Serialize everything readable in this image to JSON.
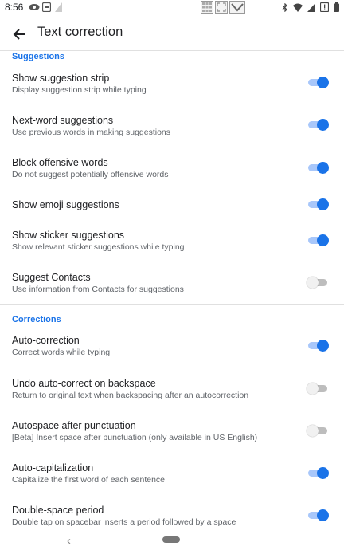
{
  "statusbar": {
    "time": "8:56"
  },
  "appbar": {
    "title": "Text correction"
  },
  "sections": [
    {
      "header": "Suggestions",
      "items": [
        {
          "title": "Show suggestion strip",
          "summary": "Display suggestion strip while typing",
          "on": true
        },
        {
          "title": "Next-word suggestions",
          "summary": "Use previous words in making suggestions",
          "on": true
        },
        {
          "title": "Block offensive words",
          "summary": "Do not suggest potentially offensive words",
          "on": true
        },
        {
          "title": "Show emoji suggestions",
          "summary": "",
          "on": true
        },
        {
          "title": "Show sticker suggestions",
          "summary": "Show relevant sticker suggestions while typing",
          "on": true
        },
        {
          "title": "Suggest Contacts",
          "summary": "Use information from Contacts for suggestions",
          "on": false
        }
      ]
    },
    {
      "header": "Corrections",
      "items": [
        {
          "title": "Auto-correction",
          "summary": "Correct words while typing",
          "on": true
        },
        {
          "title": "Undo auto-correct on backspace",
          "summary": "Return to original text when backspacing after an autocorrection",
          "on": false
        },
        {
          "title": "Autospace after punctuation",
          "summary": "[Beta] Insert space after punctuation (only available in US English)",
          "on": false
        },
        {
          "title": "Auto-capitalization",
          "summary": "Capitalize the first word of each sentence",
          "on": true
        },
        {
          "title": "Double-space period",
          "summary": "Double tap on spacebar inserts a period followed by a space",
          "on": true
        }
      ]
    }
  ],
  "colors": {
    "accent": "#1a73e8",
    "track_on": "#a8c7fa"
  },
  "icons": {
    "appbar_back": "arrow-back-icon",
    "nav_back": "nav-back-icon",
    "nav_home": "home-pill-icon"
  }
}
